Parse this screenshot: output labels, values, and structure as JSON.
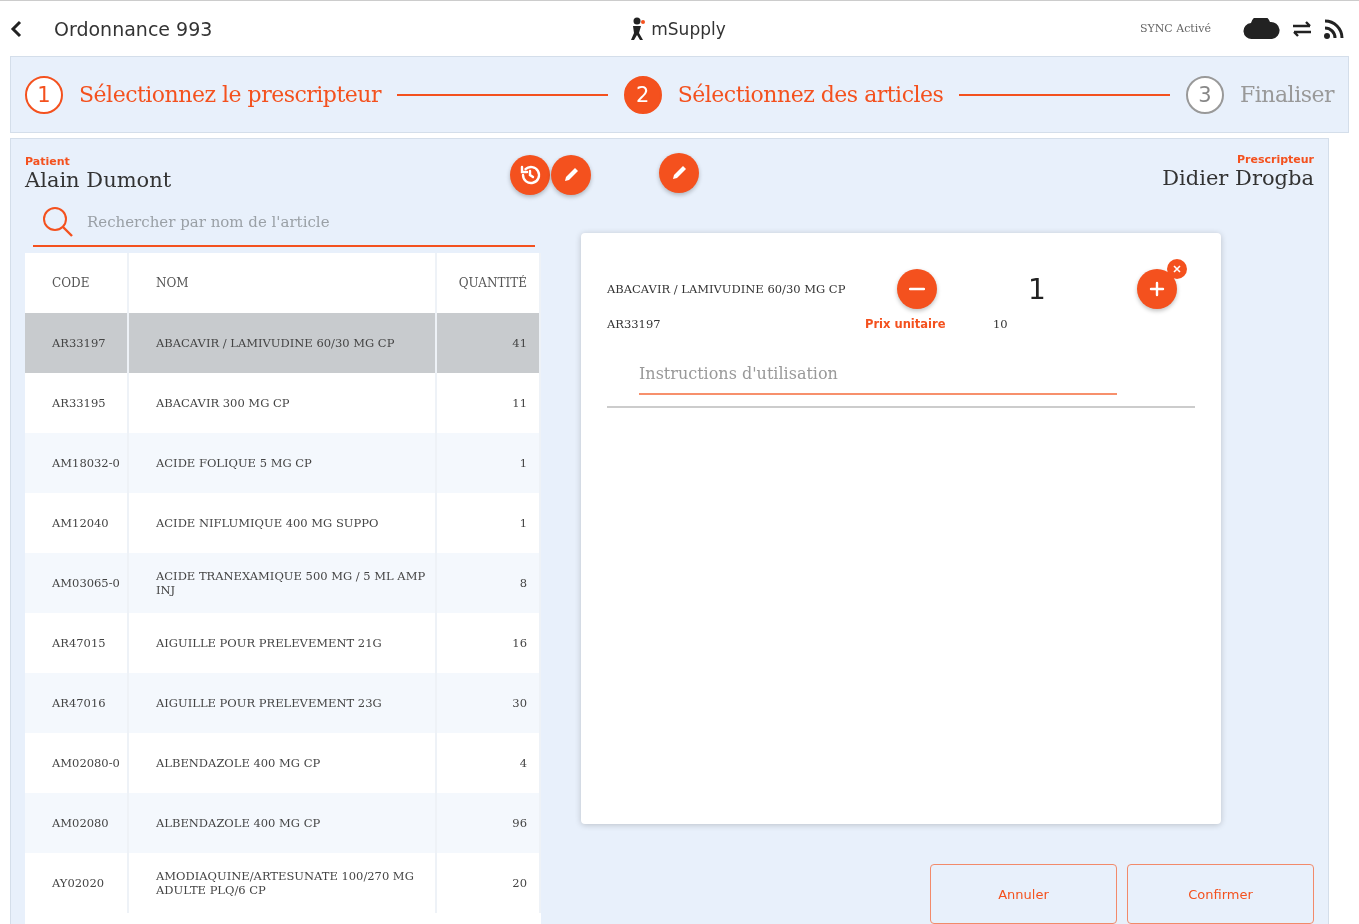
{
  "header": {
    "title": "Ordonnance 993",
    "brand": "mSupply",
    "sync_status": "SYNC Activé"
  },
  "steps": [
    {
      "number": "1",
      "label": "Sélectionnez le prescripteur",
      "completed": true,
      "selected": false
    },
    {
      "number": "2",
      "label": "Sélectionnez des articles",
      "completed": false,
      "selected": true
    },
    {
      "number": "3",
      "label": "Finaliser",
      "completed": false,
      "selected": false
    }
  ],
  "patient": {
    "caption": "Patient",
    "name": "Alain Dumont"
  },
  "prescriber": {
    "caption": "Prescripteur",
    "name": "Didier Drogba"
  },
  "search": {
    "placeholder": "Rechercher par nom de l'article"
  },
  "table": {
    "columns": [
      "CODE",
      "NOM",
      "QUANTITÉ"
    ],
    "rows": [
      {
        "code": "AR33197",
        "name": "ABACAVIR / LAMIVUDINE 60/30 MG CP",
        "quantity": "41",
        "selected": true
      },
      {
        "code": "AR33195",
        "name": "ABACAVIR 300 MG CP",
        "quantity": "11",
        "selected": false
      },
      {
        "code": "AM18032-0",
        "name": "ACIDE FOLIQUE 5 MG CP",
        "quantity": "1",
        "selected": false
      },
      {
        "code": "AM12040",
        "name": "ACIDE NIFLUMIQUE 400 MG SUPPO",
        "quantity": "1",
        "selected": false
      },
      {
        "code": "AM03065-0",
        "name": "ACIDE TRANEXAMIQUE 500 MG / 5 ML AMP INJ",
        "quantity": "8",
        "selected": false
      },
      {
        "code": "AR47015",
        "name": "AIGUILLE POUR PRELEVEMENT  21G",
        "quantity": "16",
        "selected": false
      },
      {
        "code": "AR47016",
        "name": "AIGUILLE POUR PRELEVEMENT 23G",
        "quantity": "30",
        "selected": false
      },
      {
        "code": "AM02080-0",
        "name": "ALBENDAZOLE 400 MG CP",
        "quantity": "4",
        "selected": false
      },
      {
        "code": "AM02080",
        "name": "ALBENDAZOLE 400 MG CP",
        "quantity": "96",
        "selected": false
      },
      {
        "code": "AY02020",
        "name": "AMODIAQUINE/ARTESUNATE 100/270 MG ADULTE PLQ/6 CP",
        "quantity": "20",
        "selected": false
      }
    ]
  },
  "items": [
    {
      "name": "ABACAVIR / LAMIVUDINE 60/30 MG CP",
      "quantity": "1",
      "code": "AR33197",
      "price_label": "Prix unitaire",
      "price": "10",
      "instructions_placeholder": "Instructions d'utilisation"
    }
  ],
  "buttons": [
    "Annuler",
    "Confirmer"
  ]
}
